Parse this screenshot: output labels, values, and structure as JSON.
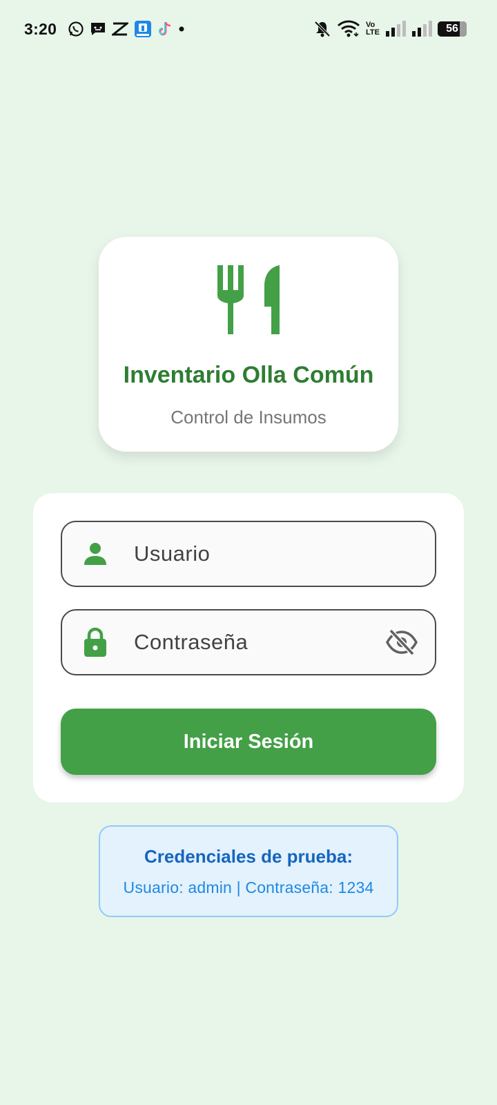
{
  "status_bar": {
    "time": "3:20",
    "left_icons": [
      "whatsapp-icon",
      "message-icon",
      "capcut-icon",
      "app-icon",
      "tiktok-icon",
      "dot-icon"
    ],
    "right_icons": [
      "mute-notifications-icon",
      "wifi-icon",
      "volte-icon",
      "signal-1-icon",
      "signal-2-icon",
      "battery-icon"
    ],
    "volte_top": "Vo",
    "volte_bottom": "LTE",
    "battery_level": "56"
  },
  "header_card": {
    "title": "Inventario Olla Común",
    "subtitle": "Control de Insumos",
    "icon": "restaurant-icon"
  },
  "login_form": {
    "username_placeholder": "Usuario",
    "password_placeholder": "Contraseña",
    "submit_label": "Iniciar Sesión"
  },
  "credentials_hint": {
    "title": "Credenciales de prueba:",
    "text": "Usuario: admin | Contraseña: 1234"
  },
  "colors": {
    "background": "#e8f5e9",
    "primary": "#43a047",
    "title": "#2e7d32",
    "hint_background": "#e3f2fd",
    "hint_title": "#1565c0"
  }
}
